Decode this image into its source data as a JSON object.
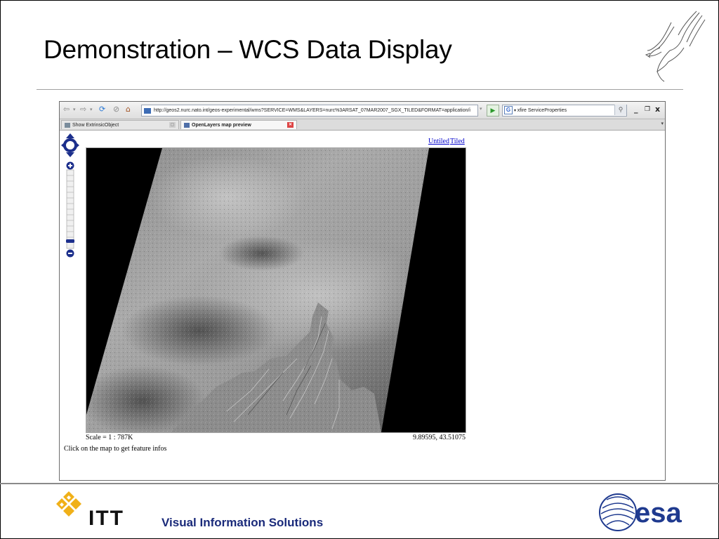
{
  "slide": {
    "title": "Demonstration – WCS Data Display",
    "footer_company": "ITT",
    "footer_division": "Visual Information Solutions",
    "footer_partner": "esa"
  },
  "browser": {
    "url": "http://geos2.nurc.nato.int/geos-experimental/wms?SERVICE=WMS&LAYERS=nurc%3ARSAT_07MAR2007_SGX_TILED&FORMAT=application/i",
    "search_engine": "G",
    "search_value": "xfire ServiceProperties",
    "tabs": [
      {
        "label": "Show ExtrinsicObject",
        "active": false
      },
      {
        "label": "OpenLayers map preview",
        "active": true
      }
    ],
    "window_controls": [
      "_",
      "❐",
      "x"
    ]
  },
  "map_page": {
    "link_untiled": "Untiled",
    "link_tiled": "Tiled",
    "scale": "Scale = 1 : 787K",
    "coordinates": "9.89595, 43.51075",
    "info": "Click on the map to get feature infos"
  },
  "colors": {
    "title_text": "#000000",
    "footer_text": "#1a2a7a",
    "esa_blue": "#1f3a8f",
    "link_blue": "#0000cc",
    "control_blue": "#1c2f8c",
    "itt_gold": "#f0b018"
  },
  "icons": {
    "back": "arrow-left-icon",
    "forward": "arrow-right-icon",
    "refresh": "refresh-icon",
    "stop": "stop-icon",
    "home": "home-icon",
    "go": "play-icon",
    "search": "magnifier-icon",
    "pan": "pan-arrows-icon",
    "zoom_in": "plus-icon",
    "zoom_out": "minus-icon"
  }
}
